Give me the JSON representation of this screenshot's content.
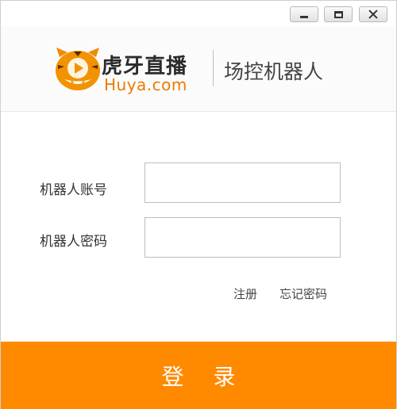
{
  "window": {
    "controls": {
      "minimize_icon": "minimize-icon",
      "maximize_icon": "maximize-icon",
      "close_icon": "close-icon"
    }
  },
  "header": {
    "brand_cn": "虎牙直播",
    "brand_en": "Huya.com",
    "product_name": "场控机器人",
    "logo_icon": "huya-tiger-logo-icon"
  },
  "form": {
    "account_label": "机器人账号",
    "account_value": "",
    "password_label": "机器人密码",
    "password_value": ""
  },
  "links": {
    "register": "注册",
    "forgot_password": "忘记密码"
  },
  "login": {
    "label": "登 录"
  },
  "colors": {
    "accent": "#ff8a00",
    "brand_orange": "#ee7a00"
  }
}
